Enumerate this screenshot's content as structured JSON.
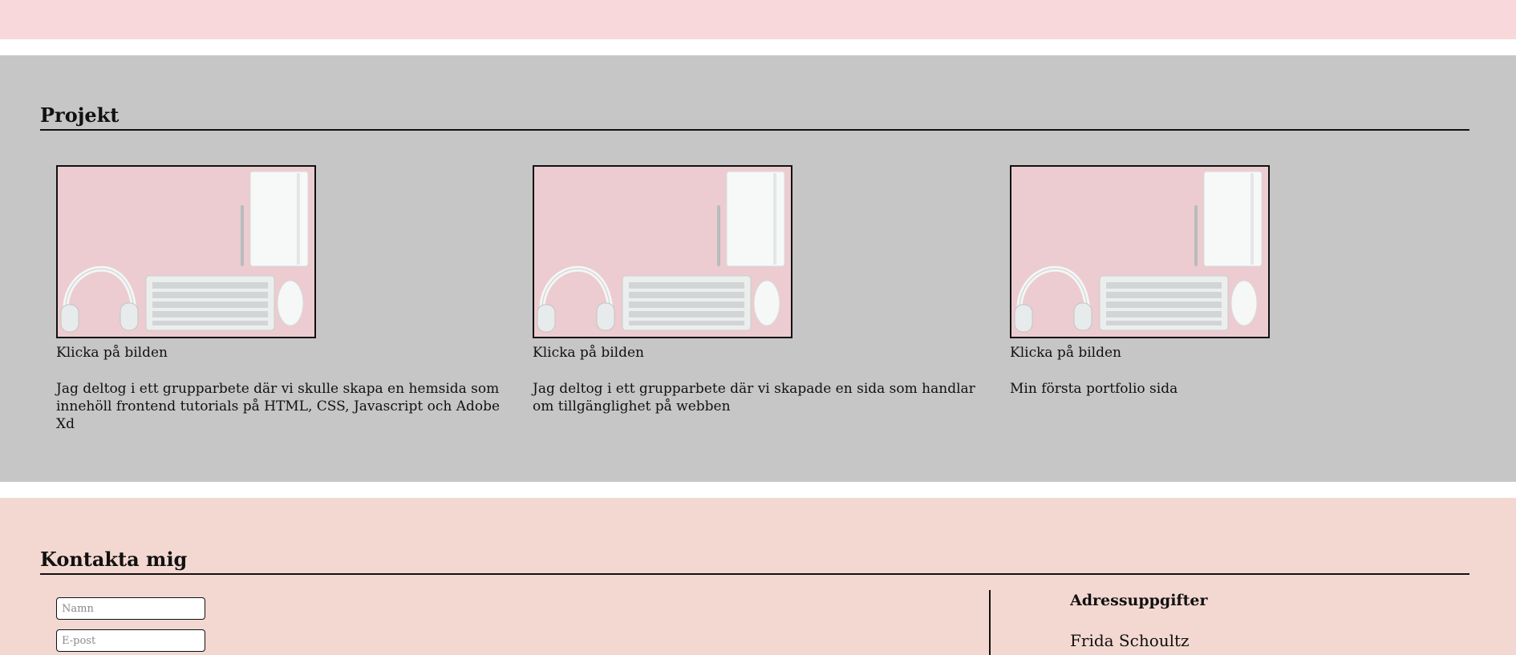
{
  "projects": {
    "title": "Projekt",
    "items": [
      {
        "link_label": "Klicka på bilden",
        "description": "Jag deltog i ett grupparbete där vi skulle skapa en hemsida som innehöll frontend tutorials på HTML, CSS, Javascript och Adobe Xd"
      },
      {
        "link_label": "Klicka på bilden",
        "description": "Jag deltog i ett grupparbete där vi skapade en sida som handlar om tillgänglighet på webben"
      },
      {
        "link_label": "Klicka på bilden",
        "description": "Min första portfolio sida"
      }
    ]
  },
  "contact": {
    "title": "Kontakta mig",
    "name_placeholder": "Namn",
    "email_placeholder": "E-post",
    "address_heading": "Adressuppgifter",
    "address_name": "Frida Schoultz"
  },
  "colors": {
    "top_band": "#f9d8db",
    "projects_bg": "#c6c6c6",
    "contact_bg": "#f3d8d1"
  }
}
